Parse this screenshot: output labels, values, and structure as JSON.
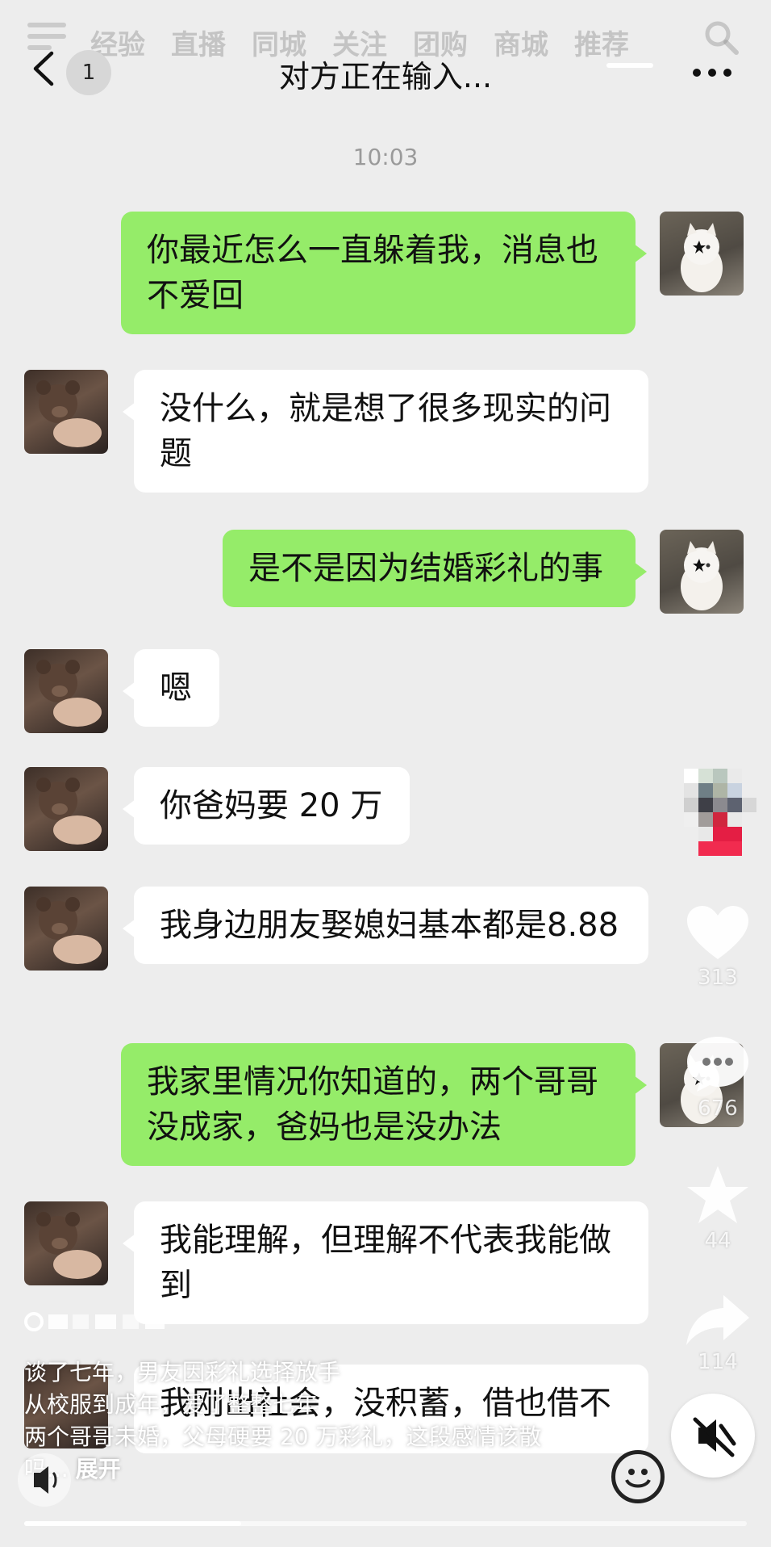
{
  "topnav": {
    "tabs": [
      "经验",
      "直播",
      "同城",
      "关注",
      "团购",
      "商城",
      "推荐"
    ]
  },
  "header": {
    "unread": "1",
    "title": "对方正在输入..."
  },
  "timestamp": "10:03",
  "messages": [
    {
      "side": "me",
      "text": "你最近怎么一直躲着我，消息也不爱回"
    },
    {
      "side": "her",
      "text": "没什么，就是想了很多现实的问题"
    },
    {
      "side": "me",
      "text": "是不是因为结婚彩礼的事"
    },
    {
      "side": "her",
      "text": "嗯"
    },
    {
      "side": "her",
      "text": "你爸妈要 20 万"
    },
    {
      "side": "her",
      "text": "我身边朋友娶媳妇基本都是8.88"
    },
    {
      "side": "me",
      "text": "我家里情况你知道的，两个哥哥没成家，爸妈也是没办法"
    },
    {
      "side": "her",
      "text": "我能理解，但理解不代表我能做到"
    },
    {
      "side": "her",
      "text": "我刚出社会，没积蓄，借也借不"
    }
  ],
  "rail": {
    "likes": "313",
    "comments": "676",
    "favorites": "44",
    "shares": "114"
  },
  "caption": {
    "line1": "谈了七年，男友因彩礼选择放手",
    "line2": "从校服到成年，爱了整整七年",
    "line3": "两个哥哥未婚，父母硬要 20 万彩礼，这段感情该散",
    "line4_prefix": "吗...",
    "expand": "展开"
  },
  "progress": 0.3
}
